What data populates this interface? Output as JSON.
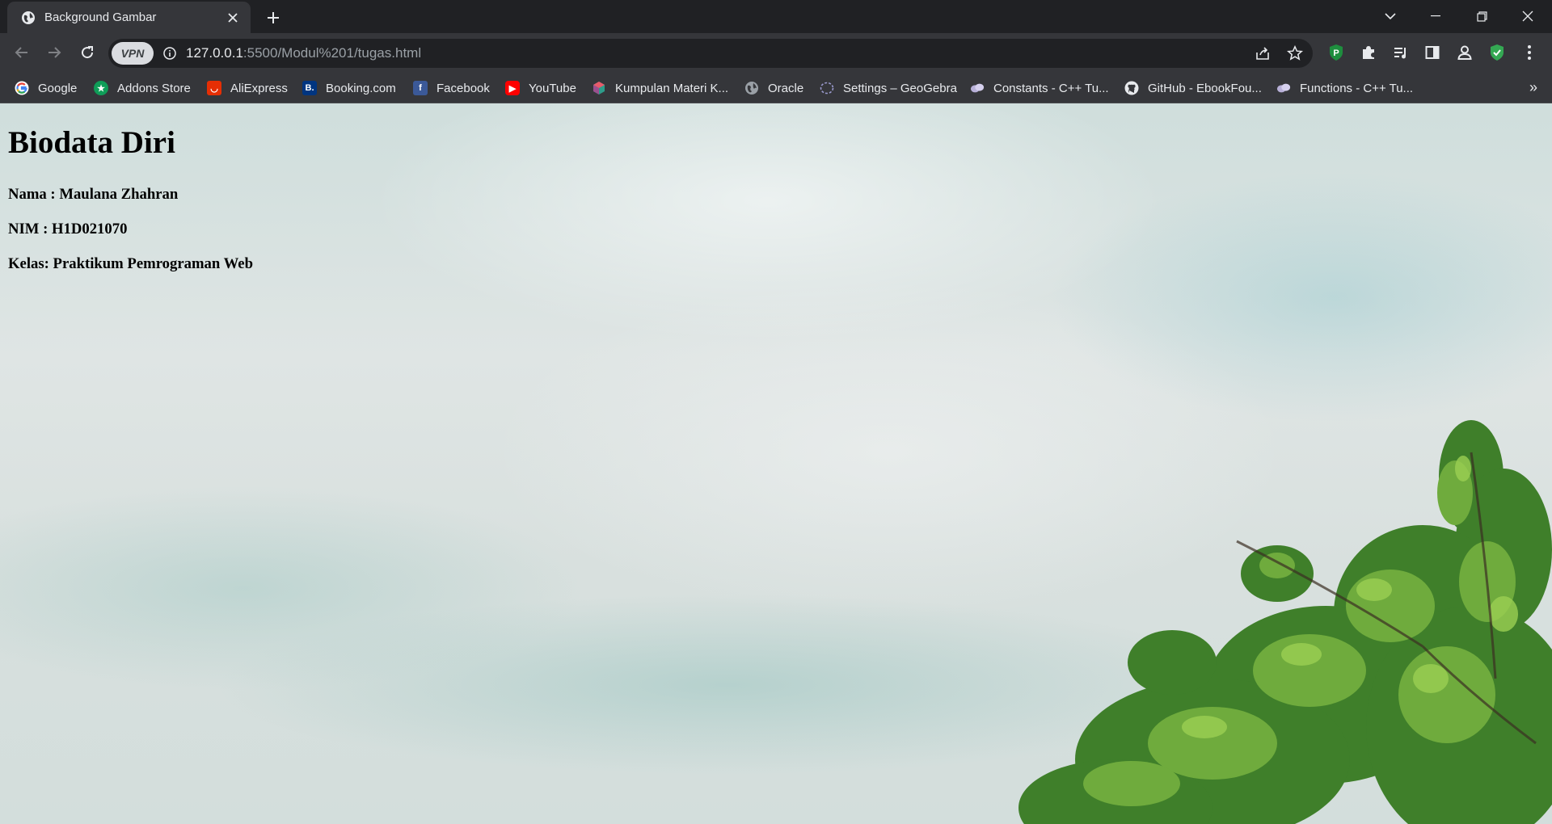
{
  "browser": {
    "tab": {
      "title": "Background Gambar",
      "favicon": "globe-icon"
    },
    "address": {
      "host": "127.0.0.1",
      "rest": ":5500/Modul%201/tugas.html",
      "vpn_label": "VPN"
    },
    "colors": {
      "frame": "#202124",
      "toolbar": "#35363a",
      "text": "#e8eaed"
    }
  },
  "bookmarks": [
    {
      "label": "Google",
      "icon": "google-icon"
    },
    {
      "label": "Addons Store",
      "icon": "addons-store-icon"
    },
    {
      "label": "AliExpress",
      "icon": "aliexpress-icon"
    },
    {
      "label": "Booking.com",
      "icon": "booking-icon"
    },
    {
      "label": "Facebook",
      "icon": "facebook-icon"
    },
    {
      "label": "YouTube",
      "icon": "youtube-icon"
    },
    {
      "label": "Kumpulan Materi K...",
      "icon": "cube-icon"
    },
    {
      "label": "Oracle",
      "icon": "globe-icon"
    },
    {
      "label": "Settings – GeoGebra",
      "icon": "geogebra-icon"
    },
    {
      "label": "Constants - C++ Tu...",
      "icon": "cplusplus-icon"
    },
    {
      "label": "GitHub - EbookFou...",
      "icon": "github-icon"
    },
    {
      "label": "Functions - C++ Tu...",
      "icon": "cplusplus-icon"
    }
  ],
  "page": {
    "heading": "Biodata Diri",
    "nama": "Nama : Maulana Zhahran",
    "nim": "NIM : H1D021070",
    "kelas": "Kelas: Praktikum Pemrograman Web"
  }
}
